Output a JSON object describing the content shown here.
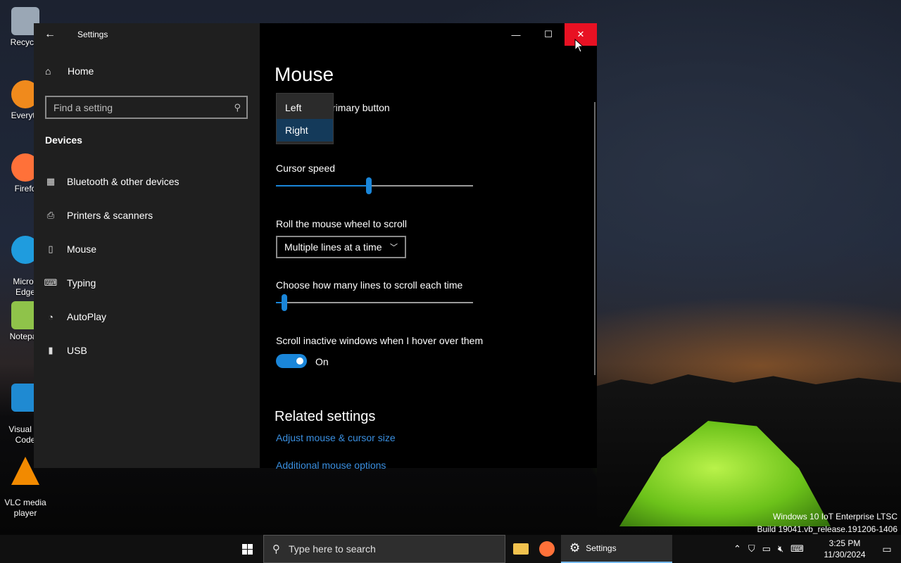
{
  "desktop": {
    "icons": [
      {
        "label": "Recycle",
        "icon": "recycle-bin-icon",
        "color": "#9aa7b5"
      },
      {
        "label": "Everyth",
        "icon": "everything-search-icon",
        "color": "#f08a1c"
      },
      {
        "label": "Firefo",
        "icon": "firefox-icon",
        "color": "#ff7139"
      },
      {
        "label": "Micros\nEdge",
        "icon": "edge-icon",
        "color": "#1f9cde"
      },
      {
        "label": "Notepac",
        "icon": "notepad-plus-icon",
        "color": "#8fc34a"
      },
      {
        "label": "Visual St\nCode",
        "icon": "vscode-icon",
        "color": "#1f8ad2"
      },
      {
        "label": "VLC media\nplayer",
        "icon": "vlc-icon",
        "color": "#f28a00"
      }
    ],
    "watermark_line1": "Windows 10 IoT Enterprise LTSC",
    "watermark_line2": "Build 19041.vb_release.191206-1406"
  },
  "window": {
    "app_title": "Settings",
    "back_icon": "back-arrow-icon",
    "caption": {
      "minimize": "—",
      "maximize": "☐",
      "close": "✕"
    },
    "sidebar": {
      "home_label": "Home",
      "search_placeholder": "Find a setting",
      "section_label": "Devices",
      "items": [
        {
          "label": "Bluetooth & other devices",
          "icon": "bluetooth-devices-icon"
        },
        {
          "label": "Printers & scanners",
          "icon": "printer-icon"
        },
        {
          "label": "Mouse",
          "icon": "mouse-icon"
        },
        {
          "label": "Typing",
          "icon": "keyboard-icon"
        },
        {
          "label": "AutoPlay",
          "icon": "autoplay-icon"
        },
        {
          "label": "USB",
          "icon": "usb-icon"
        }
      ]
    },
    "content": {
      "title": "Mouse",
      "primary_button_label": "rimary button",
      "primary_button_options": [
        "Left",
        "Right"
      ],
      "primary_button_selected": "Right",
      "cursor_speed_label": "Cursor speed",
      "cursor_speed_value": 0.47,
      "wheel_label": "Roll the mouse wheel to scroll",
      "wheel_value": "Multiple lines at a time",
      "lines_label": "Choose how many lines to scroll each time",
      "lines_value": 0.03,
      "inactive_label": "Scroll inactive windows when I hover over them",
      "inactive_state": "On",
      "related_title": "Related settings",
      "links": [
        "Adjust mouse & cursor size",
        "Additional mouse options"
      ]
    }
  },
  "taskbar": {
    "search_placeholder": "Type here to search",
    "active_app": "Settings",
    "pinned": [
      {
        "icon": "file-explorer-icon",
        "color": "#f2c24e"
      },
      {
        "icon": "firefox-icon",
        "color": "#ff7139"
      }
    ],
    "tray_icons": [
      "chevron-up-icon",
      "security-icon",
      "network-icon",
      "volume-muted-icon",
      "keyboard-icon"
    ],
    "time": "3:25 PM",
    "date": "11/30/2024"
  },
  "colors": {
    "accent": "#1a86d9",
    "close_red": "#e81123",
    "link": "#3a8fe0"
  }
}
